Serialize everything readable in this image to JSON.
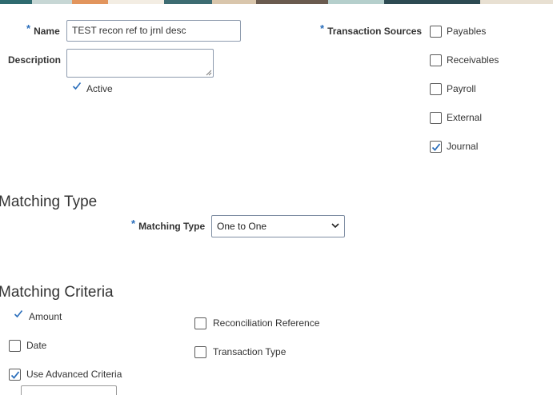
{
  "banner_colors": [
    "#2e6b6f",
    "#c7d7d5",
    "#e2955d",
    "#f3ede3",
    "#3d6c72",
    "#d9c6ac",
    "#6a5b4f",
    "#b5cfcc",
    "#2d4a52",
    "#e8e0d2"
  ],
  "form": {
    "name_label": "Name",
    "name_value": "TEST recon ref to jrnl desc",
    "description_label": "Description",
    "description_value": "",
    "active_label": "Active",
    "required_mark": "*"
  },
  "transaction_sources": {
    "label": "Transaction Sources",
    "items": [
      {
        "label": "Payables",
        "checked": false
      },
      {
        "label": "Receivables",
        "checked": false
      },
      {
        "label": "Payroll",
        "checked": false
      },
      {
        "label": "External",
        "checked": false
      },
      {
        "label": "Journal",
        "checked": true
      }
    ]
  },
  "matching_type_section": {
    "heading": "Matching Type",
    "field_label": "Matching Type",
    "selected_value": "One to One"
  },
  "matching_criteria_section": {
    "heading": "Matching Criteria",
    "amount_label": "Amount",
    "date_label": "Date",
    "date_checked": false,
    "use_advanced_label": "Use Advanced Criteria",
    "use_advanced_checked": true,
    "recon_ref_label": "Reconciliation Reference",
    "recon_ref_checked": false,
    "transaction_type_label": "Transaction Type",
    "transaction_type_checked": false
  }
}
